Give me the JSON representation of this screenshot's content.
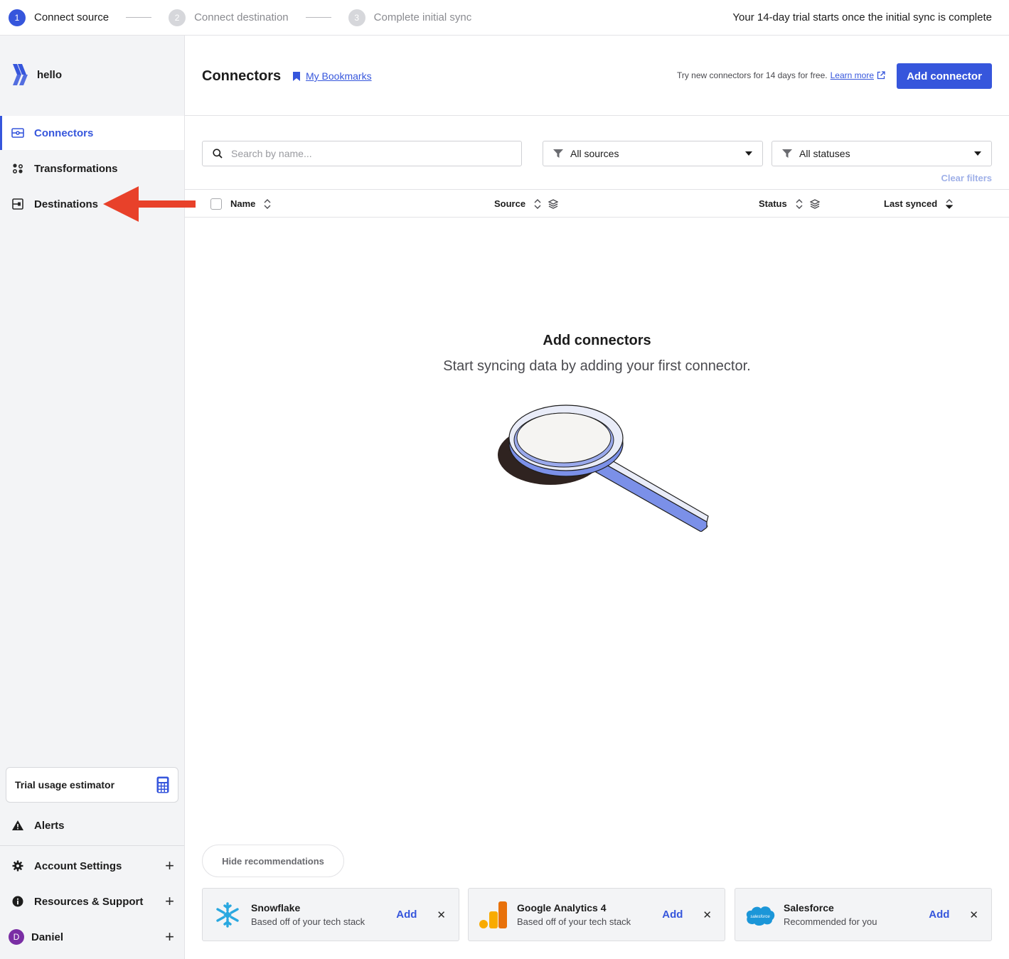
{
  "stepper": {
    "steps": [
      {
        "num": "1",
        "label": "Connect source"
      },
      {
        "num": "2",
        "label": "Connect destination"
      },
      {
        "num": "3",
        "label": "Complete initial sync"
      }
    ],
    "trial_note": "Your 14-day trial starts once the initial sync is complete"
  },
  "sidebar": {
    "workspace": "hello",
    "nav": [
      {
        "label": "Connectors",
        "icon": "connectors-icon",
        "active": true
      },
      {
        "label": "Transformations",
        "icon": "transformations-icon"
      },
      {
        "label": "Destinations",
        "icon": "destinations-icon"
      }
    ],
    "estimator_label": "Trial usage estimator",
    "alerts_label": "Alerts",
    "account_settings": "Account Settings",
    "resources_support": "Resources & Support",
    "user": {
      "name": "Daniel",
      "initial": "D"
    }
  },
  "header": {
    "title": "Connectors",
    "bookmarks_label": "My Bookmarks",
    "promo_text": "Try new connectors for 14 days for free.",
    "learn_more": "Learn more",
    "add_button": "Add connector"
  },
  "filters": {
    "search_placeholder": "Search by name...",
    "sources": "All sources",
    "statuses": "All statuses",
    "clear": "Clear filters"
  },
  "table": {
    "columns": [
      "Name",
      "Source",
      "Status",
      "Last synced"
    ]
  },
  "empty_state": {
    "title": "Add connectors",
    "subtitle": "Start syncing data by adding your first connector."
  },
  "recommendations": {
    "hide_label": "Hide recommendations",
    "add_label": "Add",
    "cards": [
      {
        "name": "Snowflake",
        "desc": "Based off of your tech stack",
        "logo": "snowflake-logo"
      },
      {
        "name": "Google Analytics 4",
        "desc": "Based off of your tech stack",
        "logo": "google-analytics-logo"
      },
      {
        "name": "Salesforce",
        "desc": "Recommended for you",
        "logo": "salesforce-logo",
        "logo_text": "salesforce"
      }
    ]
  },
  "colors": {
    "accent": "#3656dc",
    "arrow": "#e8412a",
    "sidebar_bg": "#f3f4f6"
  }
}
